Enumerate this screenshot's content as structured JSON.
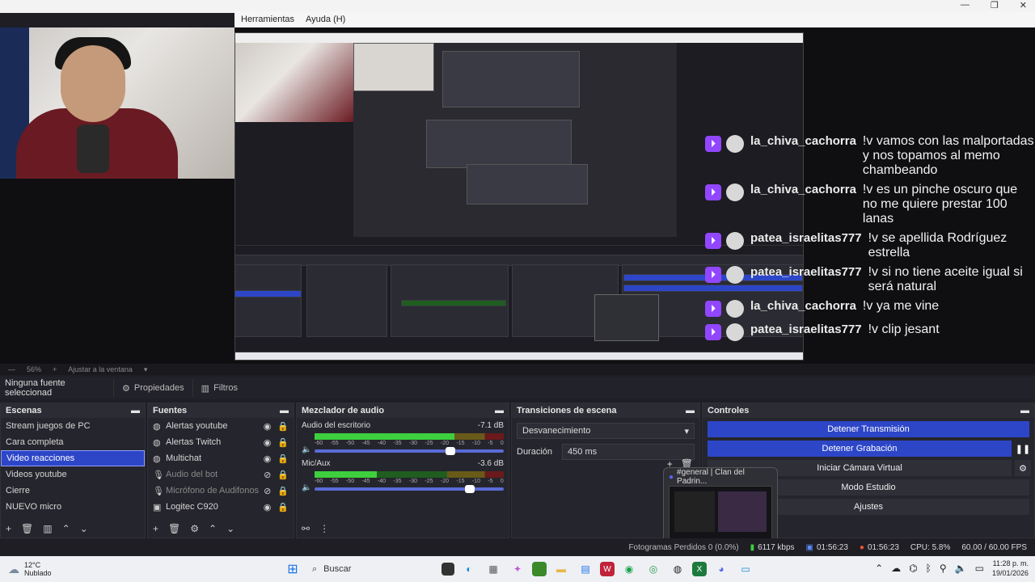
{
  "menu": {
    "items": [
      "Herramientas",
      "Ayuda (H)"
    ]
  },
  "preview": {
    "zoom": "56%",
    "fit_label": "Ajustar a la ventana",
    "chat": [
      {
        "user": "la_chiva_cachorra",
        "text": "!v vamos con las malportadas y nos topamos al memo chambeando"
      },
      {
        "user": "la_chiva_cachorra",
        "text": "!v es un pinche oscuro que no me quiere prestar 100 lanas"
      },
      {
        "user": "patea_israelitas777",
        "text": "!v se apellida Rodríguez estrella"
      },
      {
        "user": "patea_israelitas777",
        "text": "!v si no tiene aceite igual si será natural"
      },
      {
        "user": "la_chiva_cachorra",
        "text": "!v ya me vine"
      },
      {
        "user": "patea_israelitas777",
        "text": "!v clip jesant"
      }
    ]
  },
  "source_bar": {
    "selected": "Ninguna fuente seleccionad",
    "properties": "Propiedades",
    "filters": "Filtros"
  },
  "scenes": {
    "title": "Escenas",
    "items": [
      "Stream juegos de PC",
      "Cara completa",
      "Video reacciones",
      "Videos youtube",
      "Cierre",
      "NUEVO micro"
    ],
    "selected_index": 2
  },
  "sources": {
    "title": "Fuentes",
    "items": [
      {
        "name": "Alertas youtube",
        "icon": "globe-icon",
        "visible": true
      },
      {
        "name": "Alertas Twitch",
        "icon": "globe-icon",
        "visible": true
      },
      {
        "name": "Multichat",
        "icon": "globe-icon",
        "visible": true
      },
      {
        "name": "Audio del bot",
        "icon": "mic-icon",
        "visible": false
      },
      {
        "name": "Micrófono de Audifonos",
        "icon": "mic-icon",
        "visible": false
      },
      {
        "name": "Logitec C920",
        "icon": "camera-icon",
        "visible": true
      }
    ]
  },
  "mixer": {
    "title": "Mezclador de audio",
    "channels": [
      {
        "name": "Audio del escritorio",
        "db": "-7.1 dB",
        "level": 0.74,
        "volume": 0.72
      },
      {
        "name": "Mic/Aux",
        "db": "-3.6 dB",
        "level": 0.33,
        "volume": 0.82
      }
    ],
    "scale": [
      "-60",
      "-55",
      "-50",
      "-45",
      "-40",
      "-35",
      "-30",
      "-25",
      "-20",
      "-15",
      "-10",
      "-5",
      "0"
    ]
  },
  "transitions": {
    "title": "Transiciones de escena",
    "selected": "Desvanecimiento",
    "duration_label": "Duración",
    "duration_value": "450 ms"
  },
  "controls": {
    "title": "Controles",
    "buttons": [
      "Detener Transmisión",
      "Detener Grabación",
      "Iniciar Cámara Virtual",
      "Modo Estudio",
      "Ajustes"
    ]
  },
  "popup": {
    "title": "#general | Clan del Padrin..."
  },
  "status": {
    "frames": "Fotogramas Perdidos 0 (0.0%)",
    "bitrate": "6117 kbps",
    "stream_time": "01:56:23",
    "rec_time": "01:56:23",
    "cpu": "CPU: 5.8%",
    "fps": "60.00 / 60.00 FPS"
  },
  "taskbar": {
    "temp": "12°C",
    "weather": "Nublado",
    "search": "Buscar",
    "time": "11:28 p. m.",
    "date": "19/01/2026"
  },
  "colors": {
    "accent": "#2d46c8",
    "twitch": "#9146ff",
    "panel": "#25252d"
  }
}
